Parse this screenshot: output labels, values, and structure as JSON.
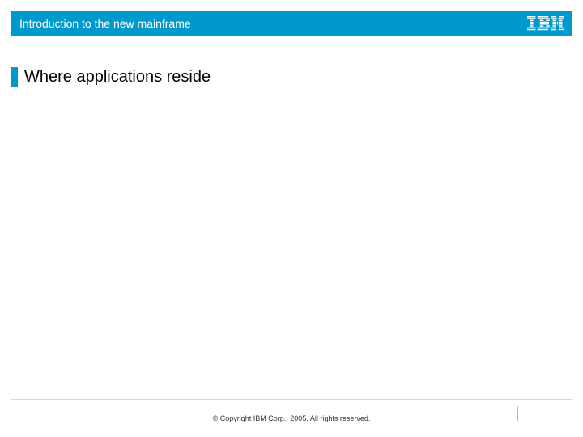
{
  "header": {
    "title": "Introduction to the new mainframe",
    "logo_name": "IBM"
  },
  "slide": {
    "title": "Where applications reside"
  },
  "footer": {
    "copyright": "© Copyright IBM Corp., 2005. All rights reserved."
  }
}
